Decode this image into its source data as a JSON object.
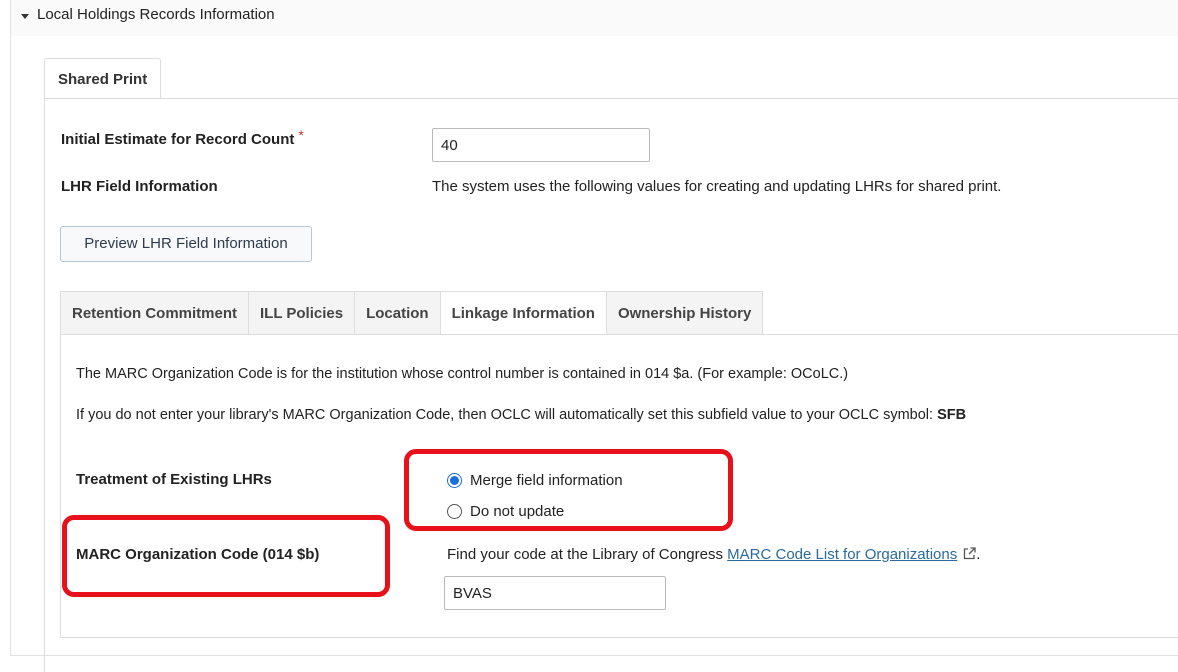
{
  "section": {
    "title": "Local Holdings Records Information"
  },
  "outer_tab": {
    "label": "Shared Print"
  },
  "initial_estimate": {
    "label": "Initial Estimate for Record Count",
    "required_mark": "*",
    "value": "40"
  },
  "lhr_field": {
    "label": "LHR Field Information",
    "description": "The system uses the following values for creating and updating LHRs for shared print."
  },
  "preview_button": {
    "label": "Preview LHR Field Information"
  },
  "inner_tabs": [
    {
      "label": "Retention Commitment"
    },
    {
      "label": "ILL Policies"
    },
    {
      "label": "Location"
    },
    {
      "label": "Linkage Information"
    },
    {
      "label": "Ownership History"
    }
  ],
  "linkage": {
    "info_line_1": "The MARC Organization Code is for the institution whose control number is contained in 014 $a. (For example: OCoLC.)",
    "info_line_2_prefix": "If you do not enter your library's MARC Organization Code, then OCLC will automatically set this subfield value to your OCLC symbol: ",
    "info_line_2_symbol": "SFB",
    "treatment_label": "Treatment of Existing LHRs",
    "treatment_options": [
      {
        "label": "Merge field information",
        "selected": true
      },
      {
        "label": "Do not update",
        "selected": false
      }
    ],
    "marc_label": "MARC Organization Code (014 $b)",
    "marc_help_prefix": "Find your code at the Library of Congress ",
    "marc_help_link": "MARC Code List for Organizations",
    "marc_help_suffix": ".",
    "marc_value": "BVAS"
  },
  "colors": {
    "highlight": "#e8101a",
    "link": "#2a6aa0",
    "radio_accent": "#1a6fd8"
  },
  "icons": {
    "caret": "caret-down-icon",
    "external": "external-link-icon"
  }
}
